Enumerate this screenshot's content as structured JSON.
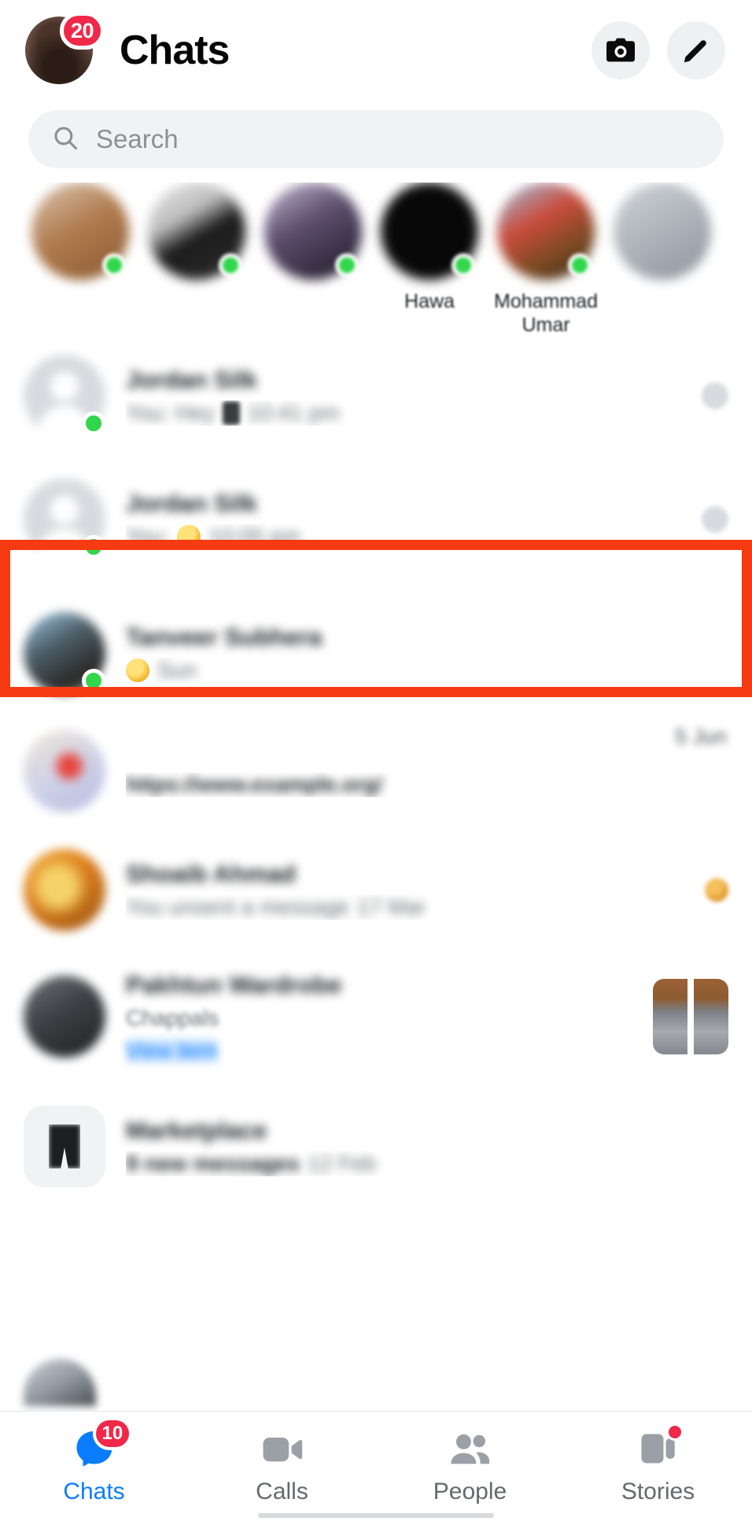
{
  "header": {
    "title": "Chats",
    "avatar_badge": "20",
    "camera_icon": "camera-icon",
    "compose_icon": "pencil-compose-icon"
  },
  "search": {
    "placeholder": "Search",
    "icon": "search-icon",
    "value": ""
  },
  "stories": [
    {
      "name": "",
      "blurred": true,
      "online": true
    },
    {
      "name": "",
      "blurred": true,
      "online": true
    },
    {
      "name": "",
      "blurred": true,
      "online": true
    },
    {
      "name": "Hawa",
      "blurred": false,
      "partial": true,
      "online": true
    },
    {
      "name": "Mohammad Umar",
      "blurred": false,
      "partial": true,
      "online": true
    },
    {
      "name": "",
      "blurred": true,
      "online": false
    }
  ],
  "chats": [
    {
      "name": "",
      "preview": "",
      "timestamp": "",
      "online": true,
      "blurred": true,
      "avatar": "default-person-avatar",
      "right": "mini-circle"
    },
    {
      "name": "",
      "preview": "",
      "timestamp": "",
      "online": true,
      "blurred": true,
      "avatar": "default-person-avatar",
      "right": "mini-circle",
      "highlighted": true
    },
    {
      "name": "",
      "preview": "",
      "timestamp": "",
      "online": true,
      "blurred": true,
      "avatar": "photo-avatar",
      "right": ""
    },
    {
      "name": "",
      "preview": "",
      "timestamp": "",
      "online": false,
      "blurred": true,
      "avatar": "photo-avatar",
      "right": ""
    },
    {
      "name": "",
      "preview": "",
      "timestamp": "",
      "online": false,
      "blurred": true,
      "avatar": "photo-avatar",
      "right": "mini-orb"
    },
    {
      "name": "",
      "preview": "Chappals",
      "timestamp": "",
      "online": false,
      "blurred": true,
      "avatar": "photo-avatar",
      "right": "product-thumbnail",
      "link_label": ""
    },
    {
      "name": "Marketplace",
      "preview": "9 new messages",
      "timestamp": "",
      "online": false,
      "blurred": true,
      "avatar": "marketplace-icon",
      "right": ""
    }
  ],
  "annotation": {
    "color": "#F63A12",
    "target": "second-chat-row"
  },
  "bottom_nav": [
    {
      "label": "Chats",
      "icon": "chat-bubble-icon",
      "active": true,
      "badge": "10"
    },
    {
      "label": "Calls",
      "icon": "video-camera-icon",
      "active": false,
      "badge": ""
    },
    {
      "label": "People",
      "icon": "people-icon",
      "active": false,
      "badge": ""
    },
    {
      "label": "Stories",
      "icon": "stories-icon",
      "active": false,
      "badge": "",
      "dot": true
    }
  ],
  "colors": {
    "accent": "#0A7CFF",
    "badge": "#F02849",
    "online": "#31D64B",
    "annotation": "#F63A12",
    "text_primary": "#1C1E21",
    "text_secondary": "#65686C"
  }
}
